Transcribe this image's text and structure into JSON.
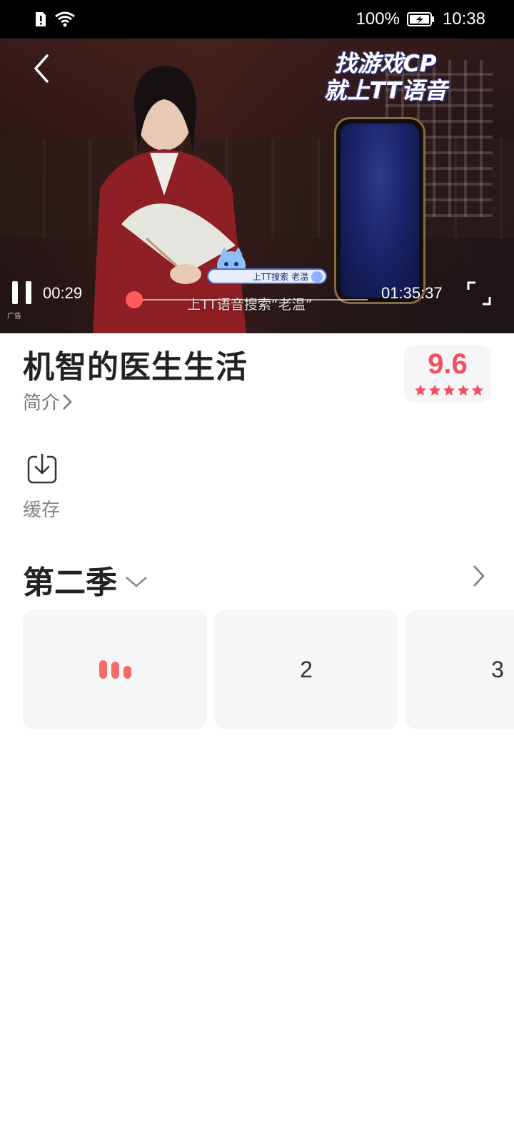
{
  "status_bar": {
    "battery": "100%",
    "time": "10:38"
  },
  "video": {
    "ad_headline_line1": "找游戏CP",
    "ad_headline_line2": "就上TT语音",
    "ad_search_pill": "上TT搜索 老温",
    "ad_tag": "广告",
    "subtitle": "上TT语音搜索“老温”",
    "current_time": "00:29",
    "total_time": "01:35:37",
    "progress_fraction": 0.005
  },
  "info": {
    "title": "机智的医生生活",
    "intro_label": "简介",
    "rating": "9.6",
    "stars": 5
  },
  "actions": {
    "cache_label": "缓存"
  },
  "season": {
    "title": "第二季",
    "episodes": [
      {
        "label": "",
        "playing": true
      },
      {
        "label": "2",
        "playing": false
      },
      {
        "label": "3",
        "playing": false
      }
    ]
  },
  "colors": {
    "accent": "#f3505f",
    "seek": "#ff5b5b"
  }
}
